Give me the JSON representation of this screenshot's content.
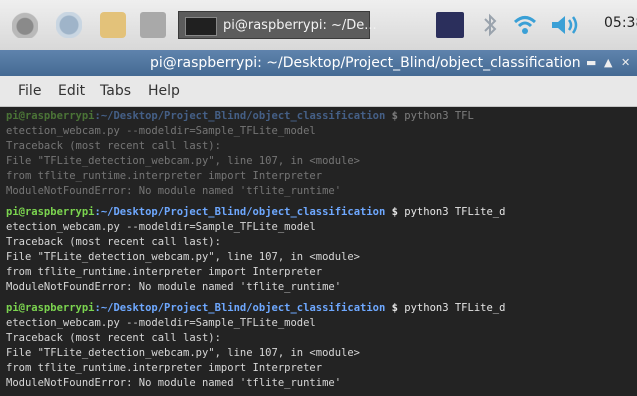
{
  "taskbar": {
    "task_label": "pi@raspberrypi: ~/De...",
    "clock": "05:38",
    "icons": [
      "raspberry-menu-icon",
      "web-browser-icon",
      "file-manager-icon",
      "terminal-icon",
      "vnc-icon",
      "bluetooth-icon",
      "wifi-icon",
      "volume-icon"
    ]
  },
  "window": {
    "title": "pi@raspberrypi: ~/Desktop/Project_Blind/object_classification",
    "controls": [
      "minimize",
      "maximize",
      "close"
    ]
  },
  "menubar": {
    "items": [
      "File",
      "Edit",
      "Tabs",
      "Help"
    ]
  },
  "terminal": {
    "lines": [
      {
        "user": "pi@raspberrypi",
        "path": ":~/Desktop/Project_Blind/object_classification",
        "sign": " $",
        "cmd": " python3 TFL"
      },
      {
        "text": "etection_webcam.py --modeldir=Sample_TFLite_model"
      },
      {
        "text": "Traceback (most recent call last):"
      },
      {
        "text": "  File \"TFLite_detection_webcam.py\", line 107, in <module>"
      },
      {
        "text": "    from tflite_runtime.interpreter import Interpreter"
      },
      {
        "text": "ModuleNotFoundError: No module named 'tflite_runtime'"
      },
      {
        "user": "pi@raspberrypi",
        "path": ":~/Desktop/Project_Blind/object_classification",
        "sign": " $",
        "cmd": " python3 TFLite_d"
      },
      {
        "text": "etection_webcam.py --modeldir=Sample_TFLite_model"
      },
      {
        "text": "Traceback (most recent call last):"
      },
      {
        "text": "  File \"TFLite_detection_webcam.py\", line 107, in <module>"
      },
      {
        "text": "    from tflite_runtime.interpreter import Interpreter"
      },
      {
        "text": "ModuleNotFoundError: No module named 'tflite_runtime'"
      },
      {
        "user": "pi@raspberrypi",
        "path": ":~/Desktop/Project_Blind/object_classification",
        "sign": " $",
        "cmd": " python3 TFLite_d"
      },
      {
        "text": "etection_webcam.py --modeldir=Sample_TFLite_model"
      },
      {
        "text": "Traceback (most recent call last):"
      },
      {
        "text": "  File \"TFLite_detection_webcam.py\", line 107, in <module>"
      },
      {
        "text": "    from tflite_runtime.interpreter import Interpreter"
      },
      {
        "text": "ModuleNotFoundError: No module named 'tflite_runtime'"
      }
    ]
  },
  "colors": {
    "terminal_bg": "#232323",
    "prompt_user": "#7bd44f",
    "prompt_path": "#6ea8ff",
    "titlebar": "#5278a3"
  }
}
